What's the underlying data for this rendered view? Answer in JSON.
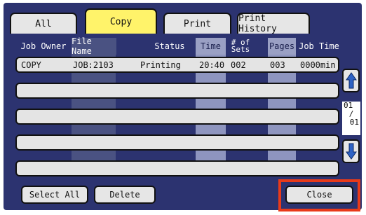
{
  "tabs": [
    {
      "label": "All"
    },
    {
      "label": "Copy"
    },
    {
      "label": "Print"
    },
    {
      "label": "Print History"
    }
  ],
  "columns": {
    "job_owner": "Job Owner",
    "file_name": "File Name",
    "status": "Status",
    "time": "Time",
    "sets_line1": "# of",
    "sets_line2": "Sets",
    "pages": "Pages",
    "job_time": "Job Time"
  },
  "jobs": [
    {
      "owner": "COPY",
      "file": "JOB:2103",
      "status": "Printing",
      "time": "20:40",
      "sets": "002",
      "pages": "003",
      "job_time": "0000min"
    }
  ],
  "pager": {
    "current": "01",
    "sep": "/",
    "total": "01",
    "up_icon": "up-arrow-icon",
    "down_icon": "down-arrow-icon"
  },
  "buttons": {
    "select_all": "Select All",
    "delete": "Delete",
    "close": "Close"
  },
  "colors": {
    "panel": "#2c3370",
    "active_tab": "#fff36a",
    "highlight": "#e83a1a"
  }
}
